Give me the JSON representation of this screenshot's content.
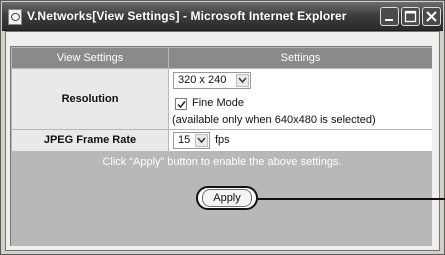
{
  "window": {
    "title": "V.Networks[View Settings] - Microsoft Internet Explorer"
  },
  "table": {
    "col_headers": [
      "View Settings",
      "Settings"
    ],
    "resolution": {
      "label": "Resolution",
      "selected": "320 x 240",
      "fine_mode_label": "Fine Mode",
      "fine_mode_checked": true,
      "note": "(available only when 640x480 is selected)"
    },
    "frame_rate": {
      "label": "JPEG Frame Rate",
      "selected": "15",
      "unit": "fps"
    },
    "notice": "Click “Apply” button to enable the above settings."
  },
  "apply_label": "Apply",
  "icons": [
    "ie-page-icon",
    "minimize-icon",
    "maximize-icon",
    "close-icon",
    "chevron-down-icon",
    "checkmark-icon"
  ]
}
